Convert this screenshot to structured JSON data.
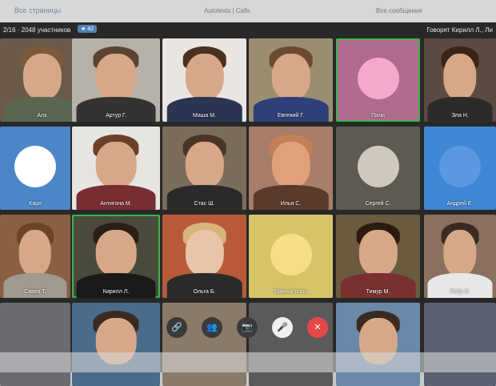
{
  "topbar": {
    "back": "Все страницы",
    "title": "Autotests | Calls",
    "right": "Все сообщения"
  },
  "header": {
    "count": "2/16 · 2048 участников",
    "badge": "★ 42",
    "speaking": "Говорят Кирилл Л., Ли"
  },
  "tiles": [
    {
      "name": "Алх"
    },
    {
      "name": "Артур Г."
    },
    {
      "name": "Маша М."
    },
    {
      "name": "Евгений Г."
    },
    {
      "name": "Пили"
    },
    {
      "name": "Эла Н."
    },
    {
      "name": "Карл"
    },
    {
      "name": "Антигона М."
    },
    {
      "name": "Стас Ш."
    },
    {
      "name": "Илья С."
    },
    {
      "name": "Сергей С."
    },
    {
      "name": "Андрей Е."
    },
    {
      "name": "Савва Т."
    },
    {
      "name": "Кирилл Л."
    },
    {
      "name": "Ольга Б."
    },
    {
      "name": "Тайный гость"
    },
    {
      "name": "Тимур М."
    },
    {
      "name": "Петр Ф."
    },
    {
      "name": ""
    },
    {
      "name": ""
    },
    {
      "name": ""
    },
    {
      "name": ""
    },
    {
      "name": ""
    },
    {
      "name": ""
    }
  ],
  "controls": {
    "link": "🔗",
    "people": "👥",
    "camera": "📷",
    "mic": "🎤",
    "end": "✕"
  },
  "colors": {
    "accent": "#5181b8",
    "active": "#3bb54a",
    "end": "#e64646"
  }
}
